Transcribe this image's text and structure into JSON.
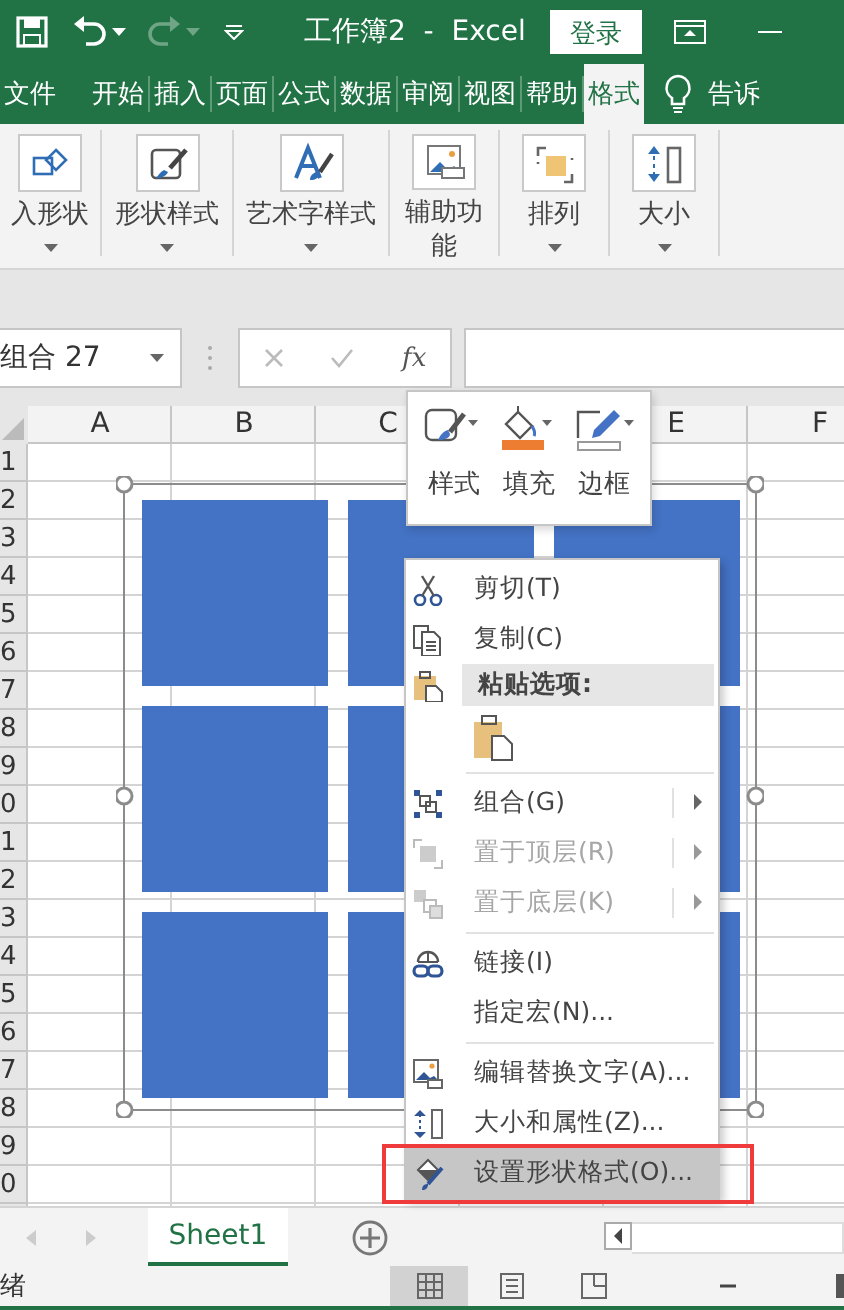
{
  "title_bar": {
    "title": "工作簿2  -  Excel",
    "login_button": "登录"
  },
  "ribbon_tabs": [
    {
      "label": "文件",
      "selected": false
    },
    {
      "label": "开始",
      "selected": false
    },
    {
      "label": "插入",
      "selected": false
    },
    {
      "label": "页面",
      "selected": false
    },
    {
      "label": "公式",
      "selected": false
    },
    {
      "label": "数据",
      "selected": false
    },
    {
      "label": "审阅",
      "selected": false
    },
    {
      "label": "视图",
      "selected": false
    },
    {
      "label": "帮助",
      "selected": false
    },
    {
      "label": "格式",
      "selected": true
    }
  ],
  "tell_me": "告诉",
  "ribbon_groups": [
    {
      "label": "入形状"
    },
    {
      "label": "形状样式"
    },
    {
      "label": "艺术字样式"
    },
    {
      "label": "辅助功能"
    },
    {
      "label": "排列"
    },
    {
      "label": "大小"
    }
  ],
  "formula_bar": {
    "name_box": "组合 27",
    "function_button": "fx"
  },
  "column_headers": [
    "A",
    "B",
    "C",
    "E",
    "F"
  ],
  "row_numbers": [
    "1",
    "2",
    "3",
    "4",
    "5",
    "6",
    "7",
    "8",
    "9",
    "0",
    "1",
    "2",
    "3",
    "4",
    "5",
    "6",
    "7",
    "8",
    "9",
    "0"
  ],
  "shape_group": {
    "selected": true,
    "shapes": [
      {
        "kind": "rectangle"
      },
      {
        "kind": "rectangle"
      },
      {
        "kind": "rectangle"
      },
      {
        "kind": "rectangle"
      },
      {
        "kind": "rectangle"
      },
      {
        "kind": "rectangle"
      },
      {
        "kind": "rectangle"
      },
      {
        "kind": "rectangle"
      },
      {
        "kind": "rectangle"
      }
    ]
  },
  "mini_toolbar": [
    {
      "label": "样式"
    },
    {
      "label": "填充"
    },
    {
      "label": "边框"
    }
  ],
  "context_menu": {
    "items": [
      {
        "kind": "item",
        "label": "剪切(T)",
        "disabled": false,
        "submenu": false,
        "selected": false,
        "outlined": false
      },
      {
        "kind": "item",
        "label": "复制(C)",
        "disabled": false,
        "submenu": false,
        "selected": false,
        "outlined": false
      },
      {
        "kind": "header",
        "label": "粘贴选项:"
      },
      {
        "kind": "paste_options"
      },
      {
        "kind": "separator"
      },
      {
        "kind": "item",
        "label": "组合(G)",
        "disabled": false,
        "submenu": true,
        "selected": false,
        "outlined": false
      },
      {
        "kind": "item",
        "label": "置于顶层(R)",
        "disabled": true,
        "submenu": true,
        "selected": false,
        "outlined": false
      },
      {
        "kind": "item",
        "label": "置于底层(K)",
        "disabled": true,
        "submenu": true,
        "selected": false,
        "outlined": false
      },
      {
        "kind": "separator"
      },
      {
        "kind": "item",
        "label": "链接(I)",
        "disabled": false,
        "submenu": false,
        "selected": false,
        "outlined": false
      },
      {
        "kind": "item",
        "label": "指定宏(N)...",
        "disabled": false,
        "submenu": false,
        "selected": false,
        "outlined": false
      },
      {
        "kind": "separator"
      },
      {
        "kind": "item",
        "label": "编辑替换文字(A)...",
        "disabled": false,
        "submenu": false,
        "selected": false,
        "outlined": false
      },
      {
        "kind": "item",
        "label": "大小和属性(Z)...",
        "disabled": false,
        "submenu": false,
        "selected": false,
        "outlined": false
      },
      {
        "kind": "item",
        "label": "设置形状格式(O)...",
        "disabled": false,
        "submenu": false,
        "selected": true,
        "outlined": true
      }
    ]
  },
  "sheet_tabs": [
    {
      "label": "Sheet1",
      "selected": true
    }
  ],
  "status_bar": {
    "status": "绪",
    "view_buttons": [
      {
        "selected": true
      },
      {
        "selected": false
      },
      {
        "selected": false
      }
    ]
  }
}
